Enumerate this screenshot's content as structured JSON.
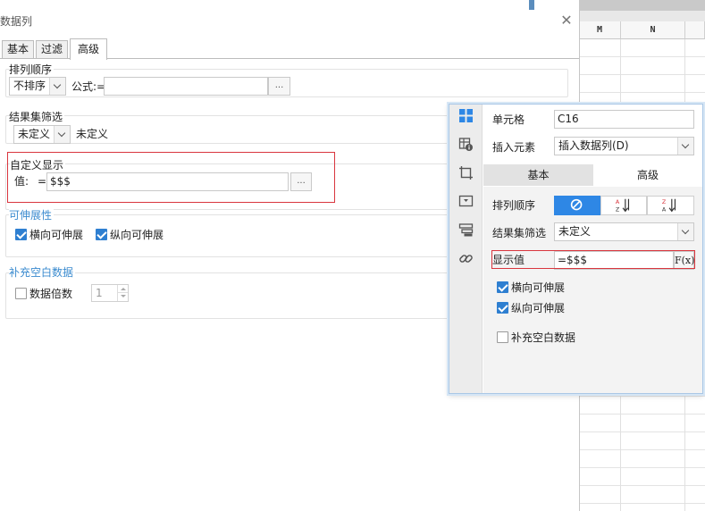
{
  "sheet": {
    "columns": [
      "M",
      "N"
    ]
  },
  "dialog": {
    "title": "数据列",
    "tabs": [
      {
        "label": "基本",
        "active": false
      },
      {
        "label": "过滤",
        "active": false
      },
      {
        "label": "高级",
        "active": true
      }
    ],
    "sort": {
      "label": "排列顺序",
      "value": "不排序",
      "formula_label": "公式:=",
      "formula_value": "",
      "dots": "..."
    },
    "filter": {
      "label": "结果集筛选",
      "value": "未定义",
      "status": "未定义"
    },
    "custom_display": {
      "label": "自定义显示",
      "value_label": "值:",
      "equals": "=",
      "value": "$$$",
      "dots": "..."
    },
    "expand": {
      "label": "可伸展性",
      "horizontal": {
        "label": "横向可伸展",
        "checked": true
      },
      "vertical": {
        "label": "纵向可伸展",
        "checked": true
      }
    },
    "blank": {
      "label": "补充空白数据",
      "multiple": {
        "label": "数据倍数",
        "checked": false
      },
      "multiple_value": "1"
    }
  },
  "panel": {
    "cell_label": "单元格",
    "cell_value": "C16",
    "insert_label": "插入元素",
    "insert_value": "插入数据列(D)",
    "tabs": [
      {
        "label": "基本",
        "active": true
      },
      {
        "label": "高级",
        "active": false
      }
    ],
    "sort_label": "排列顺序",
    "filter_label": "结果集筛选",
    "filter_value": "未定义",
    "display_label": "显示值",
    "display_value": "=$$$",
    "fx_label": "F(x)",
    "horizontal": {
      "label": "横向可伸展",
      "checked": true
    },
    "vertical": {
      "label": "纵向可伸展",
      "checked": true
    },
    "blank": {
      "label": "补充空白数据",
      "checked": false
    }
  },
  "colors": {
    "accent": "#2e87e5",
    "highlight_border": "#d9363e",
    "section_blue": "#3b8bcf"
  }
}
